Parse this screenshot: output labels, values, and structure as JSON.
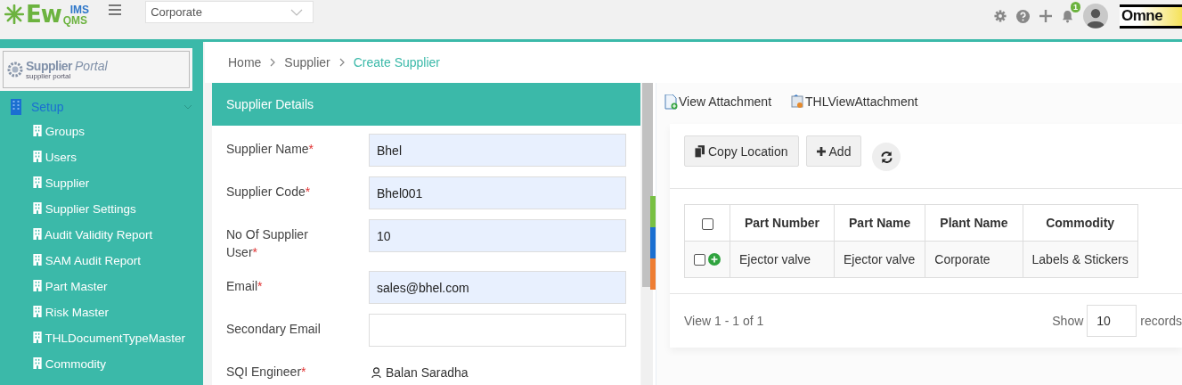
{
  "header": {
    "logo": {
      "main": "Ew",
      "top": "IMS",
      "bottom": "QMS"
    },
    "plant_select": {
      "value": "Corporate"
    },
    "notifications": {
      "count": "1"
    },
    "brand": "Omne"
  },
  "sidebar": {
    "portal_logo": {
      "title": "Supplier",
      "title_italic": "Portal",
      "subtitle": "supplier portal"
    },
    "section": {
      "label": "Setup",
      "expanded": true,
      "items": [
        {
          "label": "Groups"
        },
        {
          "label": "Users"
        },
        {
          "label": "Supplier"
        },
        {
          "label": "Supplier Settings"
        },
        {
          "label": "Audit Validity Report"
        },
        {
          "label": "SAM Audit Report"
        },
        {
          "label": "Part Master"
        },
        {
          "label": "Risk Master"
        },
        {
          "label": "THLDocumentTypeMaster"
        },
        {
          "label": "Commodity"
        }
      ]
    }
  },
  "breadcrumb": [
    {
      "label": "Home",
      "selected": false
    },
    {
      "label": "Supplier",
      "selected": false
    },
    {
      "label": "Create Supplier",
      "selected": true
    }
  ],
  "form": {
    "title": "Supplier Details",
    "fields": [
      {
        "kind": "input",
        "label": "Supplier Name",
        "required_mark": "*",
        "value": "Bhel"
      },
      {
        "kind": "input",
        "label": "Supplier Code",
        "required_mark": "*",
        "value": "Bhel001"
      },
      {
        "kind": "input",
        "label": "No Of Supplier User",
        "required_mark": "*",
        "value": "10"
      },
      {
        "kind": "input",
        "label": "Email",
        "required_mark": "*",
        "value": "sales@bhel.com"
      },
      {
        "kind": "input",
        "label": "Secondary Email"
      },
      {
        "kind": "user",
        "label": "SQI Engineer",
        "required_mark": "*",
        "value": "Balan Saradha"
      }
    ]
  },
  "attachments": [
    {
      "label": "View Attachment"
    },
    {
      "label": "THLViewAttachment"
    }
  ],
  "parts": {
    "buttons": [
      {
        "label": "Copy Location"
      },
      {
        "label": "Add"
      }
    ],
    "table": {
      "columns": [
        "Part Number",
        "Part Name",
        "Plant Name",
        "Commodity"
      ],
      "header_checked": false,
      "rows": [
        {
          "checked": false,
          "cells": [
            "Ejector valve",
            "Ejector valve",
            "Corporate",
            "Labels & Stickers"
          ]
        }
      ]
    },
    "pager": {
      "summary": "View 1 - 1 of 1",
      "show_label": "Show",
      "page_size": "10",
      "records_label": "records"
    }
  }
}
